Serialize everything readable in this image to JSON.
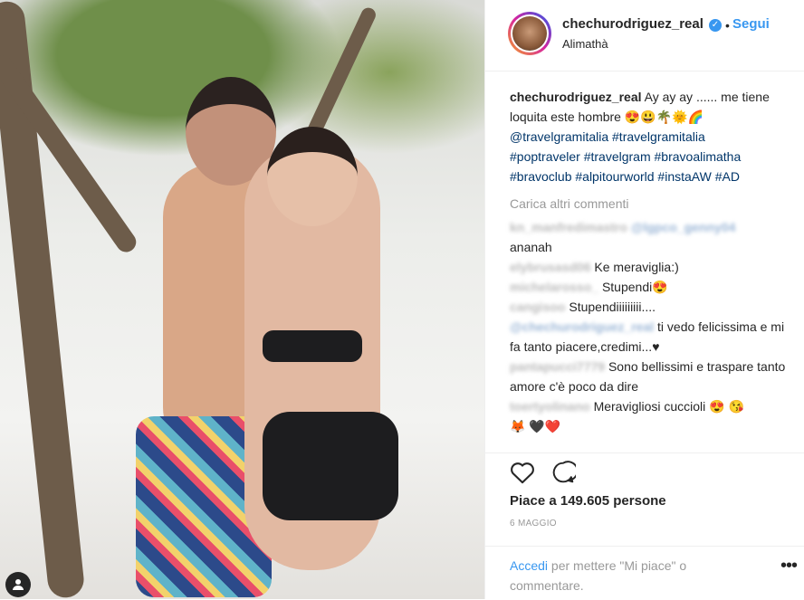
{
  "post": {
    "username": "chechurodriguez_real",
    "verified_badge": "✓",
    "separator": "•",
    "follow_label": "Segui",
    "location": "Alimathà"
  },
  "caption": {
    "username": "chechurodriguez_real",
    "text": "Ay ay ay ...... me tiene loquita este hombre",
    "emojis": [
      "😍",
      "😃",
      "🌴",
      "🌞",
      "🌈"
    ],
    "hashtags_line1": "@travelgramitalia #travelgramitalia",
    "hashtags_line2": "#poptraveler #travelgram #bravoalimatha",
    "hashtags_line3": "#bravoclub #alpitourworld #instaAW #AD"
  },
  "load_more_label": "Carica altri commenti",
  "comments": [
    {
      "user": "kn_manfredimastro",
      "mention": "@lgpco_genny04",
      "text": "ananah"
    },
    {
      "user": "elybrusasd06",
      "text": "Ke meraviglia:)"
    },
    {
      "user": "michelarosso_",
      "text": "Stupendi",
      "emoji": "😍"
    },
    {
      "user": "cangisoo",
      "text": "Stupendiiiiiiiii....",
      "mention": "@chechurodriguez_real",
      "text2": "ti vedo felicissima e mi fa tanto piacere,credimi...",
      "emoji": "♥"
    },
    {
      "user": "pantapucci7779",
      "text": "Sono bellissimi e traspare tanto amore c'è poco da dire"
    },
    {
      "user": "toertyolinano",
      "text": "Meravigliosi cuccioli",
      "emojis": [
        "😍",
        "😘",
        "🦊",
        "🖤",
        "❤️"
      ]
    }
  ],
  "actions": {
    "like_icon": "heart-outline-icon",
    "comment_icon": "comment-icon",
    "likes_text": "Piace a 149.605 persone",
    "date": "6 MAGGIO"
  },
  "login": {
    "link": "Accedi",
    "rest": "per mettere \"Mi piace\" o commentare."
  },
  "more_label": "•••",
  "colors": {
    "accent": "#3897f0",
    "hashtag": "#003569",
    "muted": "#999999"
  }
}
